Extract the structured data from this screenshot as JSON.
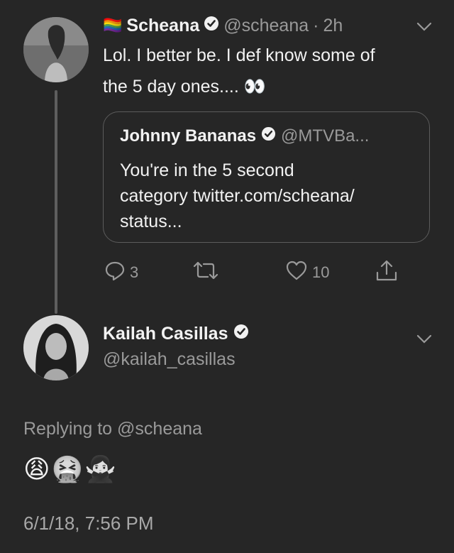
{
  "tweet1": {
    "flag_emoji": "🏳️‍🌈",
    "name": "Scheana",
    "handle": "@scheana",
    "separator": "·",
    "time": "2h",
    "text_line1": "Lol. I better be. I def know some of",
    "text_line2": "the 5 day ones.... 👀",
    "quoted": {
      "name": "Johnny Bananas",
      "handle": "@MTVBa...",
      "text_line1": "You're in the 5 second",
      "text_line2": "category twitter.com/scheana/",
      "text_line3": "status..."
    },
    "actions": {
      "reply_count": "3",
      "retweet_count": "",
      "like_count": "10"
    }
  },
  "tweet2": {
    "name": "Kailah Casillas",
    "handle": "@kailah_casillas",
    "replying_prefix": "Replying to",
    "replying_to": "@scheana",
    "emojis": "😩🤮🙅🏻‍♀️",
    "timestamp": "6/1/18, 7:56 PM"
  },
  "colors": {
    "background": "#262626",
    "text": "#f2f2f2",
    "muted": "#9a9a9a",
    "border": "#5c5c5c"
  },
  "icons": [
    "verified-badge-icon",
    "chevron-down-icon",
    "reply-icon",
    "retweet-icon",
    "like-icon",
    "share-icon"
  ]
}
